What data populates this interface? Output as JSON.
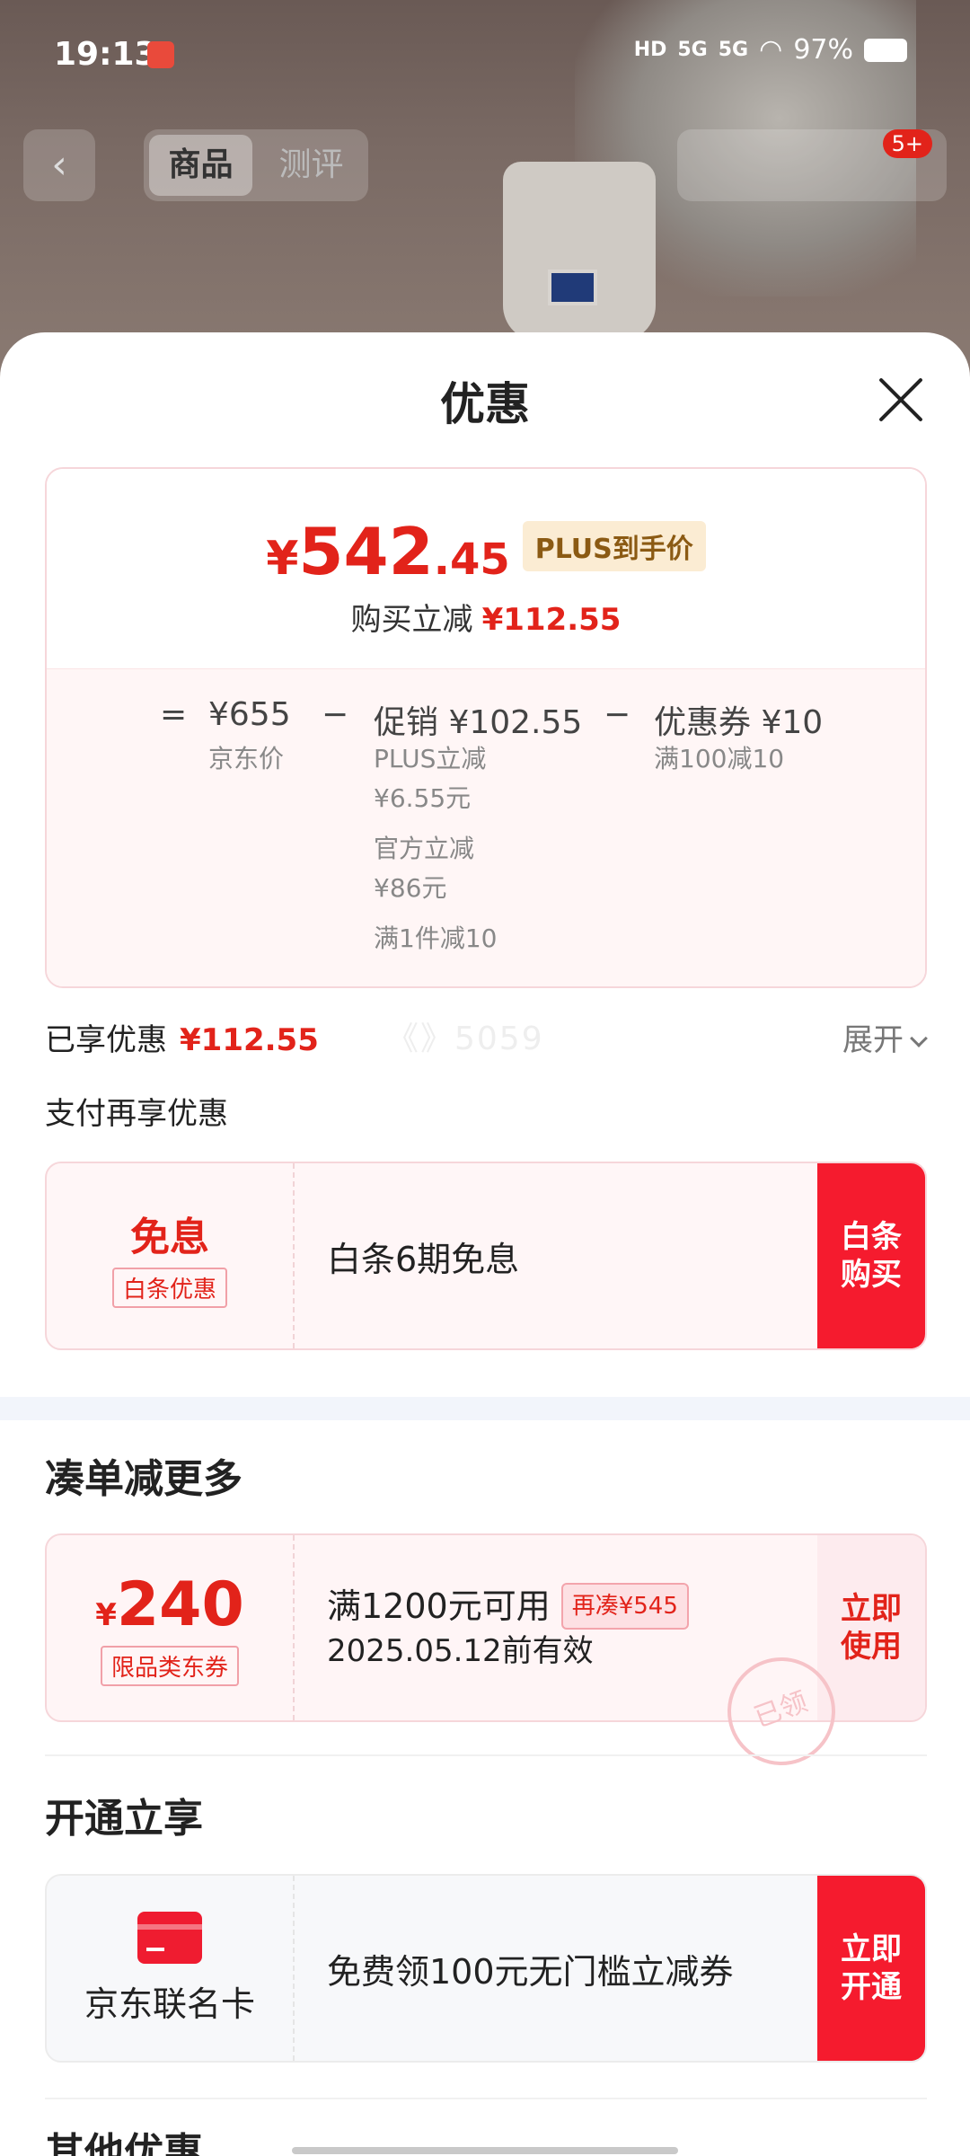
{
  "status_bar": {
    "time": "19:13",
    "net": "HD",
    "sig1": "5G",
    "sig2": "5G",
    "battery": "97%"
  },
  "top_nav": {
    "back": "‹",
    "tabs": [
      "商品",
      "测评"
    ],
    "msg_badge": "5+"
  },
  "sheet": {
    "title": "优惠",
    "price": {
      "currency": "¥",
      "integer": "542",
      "decimal": ".45",
      "tag": "PLUS到手价"
    },
    "save": {
      "label": "购买立减",
      "amount": "¥112.55"
    },
    "calc": {
      "eq": "=",
      "minus1": "−",
      "minus2": "−",
      "jd_price": "¥655",
      "jd_price_label": "京东价",
      "promo": "促销 ¥102.55",
      "promo_items": [
        "PLUS立减",
        "¥6.55元",
        "官方立减",
        "¥86元",
        "满1件减10"
      ],
      "coupon": "优惠券 ¥10",
      "coupon_desc": "满100减10"
    },
    "enjoyed": {
      "label": "已享优惠",
      "amount": "¥112.55",
      "expand": "展开"
    },
    "watermark": "《》5059",
    "pay": {
      "section": "支付再享优惠",
      "left_main": "免息",
      "left_tag": "白条优惠",
      "desc": "白条6期免息",
      "button": "白条购买"
    },
    "bundle": {
      "section": "凑单减更多",
      "currency": "¥",
      "value": "240",
      "tag": "限品类东券",
      "line1": "满1200元可用",
      "more_tag": "再凑¥545",
      "line2": "2025.05.12前有效",
      "stamp": "已领",
      "button": "立即使用"
    },
    "open": {
      "section": "开通立享",
      "card_name": "京东联名卡",
      "desc": "免费领100元无门槛立减券",
      "button": "立即开通"
    },
    "other": {
      "section": "其他优惠"
    }
  }
}
